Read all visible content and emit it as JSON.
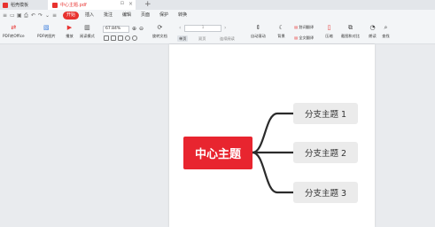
{
  "tabs": [
    {
      "label": "稻壳模板",
      "active": false
    },
    {
      "label": "中心主题.pdf",
      "active": true
    }
  ],
  "menu": {
    "items": [
      "开始",
      "插入",
      "批注",
      "编辑",
      "页面",
      "保护",
      "转换"
    ],
    "active": "开始"
  },
  "ribbon": {
    "pdf_to_office": "PDF转Office",
    "pdf_to_image": "PDF转图片",
    "play": "播放",
    "read_mode": "阅读模式",
    "zoom": "67.84%",
    "rotate": "旋转文档",
    "view_single": "单页",
    "view_double": "双页",
    "view_continuous": "连续阅读",
    "auto_scroll": "自动滚动",
    "background": "背景",
    "translate_select": "划词翻译",
    "translate_full": "全文翻译",
    "compress": "压缩",
    "screenshot_compare": "截图和对比",
    "read_aloud": "朗读",
    "find": "查找"
  },
  "mindmap": {
    "central": "中心主题",
    "branches": [
      "分支主题 1",
      "分支主题 2",
      "分支主题 3"
    ]
  },
  "colors": {
    "accent": "#e8322f",
    "central_node": "#e8252f",
    "branch_node": "#ebebeb",
    "connector": "#2b2b2b"
  }
}
